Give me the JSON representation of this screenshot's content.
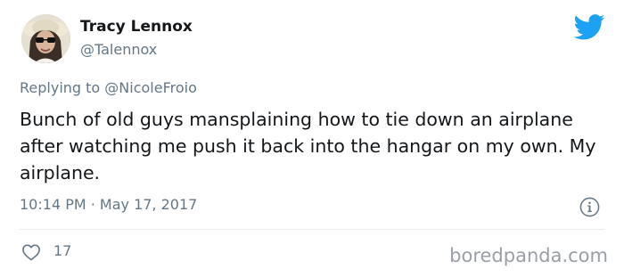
{
  "tweet": {
    "display_name": "Tracy Lennox",
    "handle": "@Talennox",
    "reply_prefix": "Replying to ",
    "reply_to": "@NicoleFroio",
    "text": "Bunch of old guys mansplaining how to tie down an airplane after watching me push it back into the hangar on my own. My airplane.",
    "timestamp": "10:14 PM · May 17, 2017",
    "like_count": "17"
  },
  "watermark": "boredpanda.com",
  "colors": {
    "twitter_blue": "#1da1f2",
    "text": "#14171a",
    "secondary": "#657786"
  },
  "icons": {
    "brand": "twitter-bird-icon",
    "info": "info-icon",
    "like": "heart-icon"
  }
}
